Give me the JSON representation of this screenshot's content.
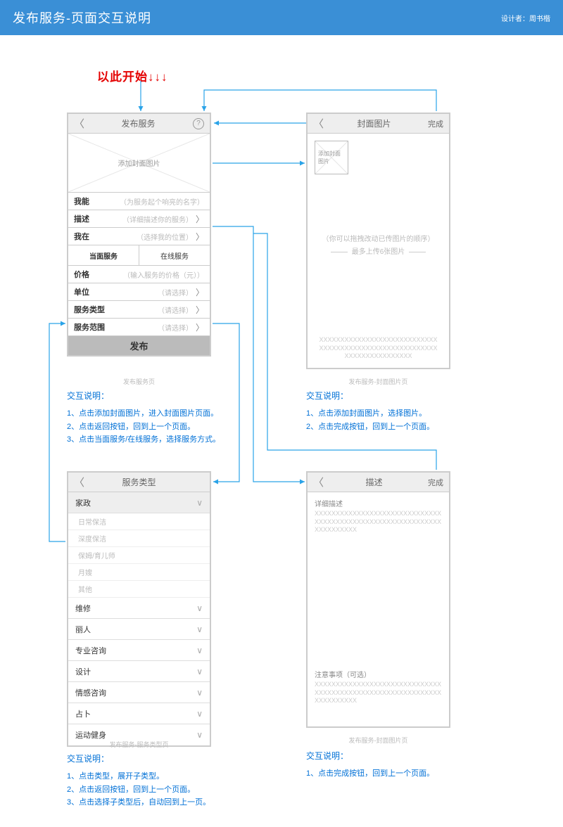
{
  "header": {
    "title": "发布服务-页面交互说明",
    "designer_label": "设计者：周书楷"
  },
  "start_label": "以此开始↓↓↓",
  "wf1": {
    "title": "发布服务",
    "cover_label": "添加封面图片",
    "rows": {
      "r1": {
        "k": "我能",
        "ph": "（为服务起个响亮的名字）",
        "chev": false
      },
      "r2": {
        "k": "描述",
        "ph": "（详细描述你的服务）",
        "chev": true
      },
      "r3": {
        "k": "我在",
        "ph": "（选择我的位置）",
        "chev": true
      },
      "r4": {
        "k": "价格",
        "ph": "（输入服务的价格（元））",
        "chev": false
      },
      "r5": {
        "k": "单位",
        "ph": "（请选择）",
        "chev": true
      },
      "r6": {
        "k": "服务类型",
        "ph": "（请选择）",
        "chev": true
      },
      "r7": {
        "k": "服务范围",
        "ph": "（请选择）",
        "chev": true
      }
    },
    "tabs": {
      "a": "当面服务",
      "b": "在线服务"
    },
    "publish": "发布",
    "caption": "发布服务页"
  },
  "wf2": {
    "title": "封面图片",
    "done": "完成",
    "thumb_label": "添加封面图片",
    "hint1": "（你可以拖拽改动已传图片的顺序）",
    "hint2": "最多上传6张图片",
    "bottom_x": "XXXXXXXXXXXXXXXXXXXXXXXXXXXXXXXXXXXXXXXXXXXXXXXXXXXXXXXXXXXXXXXXXXXXXXXX",
    "caption": "发布服务-封面图片页"
  },
  "wf3": {
    "title": "服务类型",
    "cats": {
      "c0": "家政",
      "c1": "维修",
      "c2": "丽人",
      "c3": "专业咨询",
      "c4": "设计",
      "c5": "情感咨询",
      "c6": "占卜",
      "c7": "运动健身"
    },
    "subs": {
      "s0": "日常保洁",
      "s1": "深度保洁",
      "s2": "保姆/育儿师",
      "s3": "月嫂",
      "s4": "其他"
    },
    "caption": "发布服务-服务类型页"
  },
  "wf4": {
    "title": "描述",
    "done": "完成",
    "label1": "详细描述",
    "x1": "XXXXXXXXXXXXXXXXXXXXXXXXXXXXXXXXXXXXXXXXXXXXXXXXXXXXXXXXXXXXXXXXXXXXXX",
    "label2": "注意事项（可选）",
    "x2": "XXXXXXXXXXXXXXXXXXXXXXXXXXXXXXXXXXXXXXXXXXXXXXXXXXXXXXXXXXXXXXXXXXXXXX",
    "caption": "发布服务-封面图片页"
  },
  "interact_label": "交互说明：",
  "int1": {
    "l1": "1、点击添加封面图片，进入封面图片页面。",
    "l2": "2、点击返回按钮，回到上一个页面。",
    "l3": "3、点击当面服务/在线服务，选择服务方式。"
  },
  "int2": {
    "l1": "1、点击添加封面图片，选择图片。",
    "l2": "2、点击完成按钮，回到上一个页面。"
  },
  "int3": {
    "l1": "1、点击类型，展开子类型。",
    "l2": "2、点击返回按钮，回到上一个页面。",
    "l3": "3、点击选择子类型后，自动回到上一页。"
  },
  "int4": {
    "l1": "1、点击完成按钮，回到上一个页面。"
  }
}
